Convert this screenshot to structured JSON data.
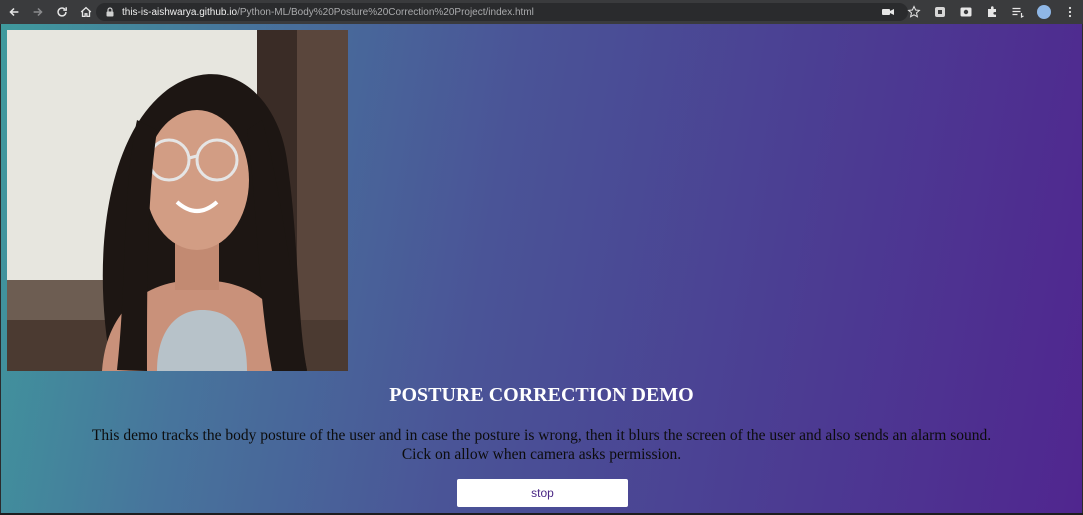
{
  "browser": {
    "url_host": "this-is-aishwarya.github.io",
    "url_path": "/Python-ML/Body%20Posture%20Correction%20Project/index.html"
  },
  "page": {
    "title": "POSTURE CORRECTION DEMO",
    "description_line1": "This demo tracks the body posture of the user and in case the posture is wrong, then it blurs the screen of the user and also sends an alarm sound.",
    "description_line2": "Cick on allow when camera asks permission.",
    "stop_label": "stop"
  },
  "colors": {
    "gradient_start": "#3f9a9d",
    "gradient_end": "#50268f",
    "button_text": "#4a2785"
  },
  "icons": [
    "back-icon",
    "forward-icon",
    "reload-icon",
    "home-icon",
    "lock-icon",
    "camera-icon",
    "star-icon",
    "extension-icon",
    "puzzle-icon",
    "media-icon",
    "profile-avatar"
  ]
}
